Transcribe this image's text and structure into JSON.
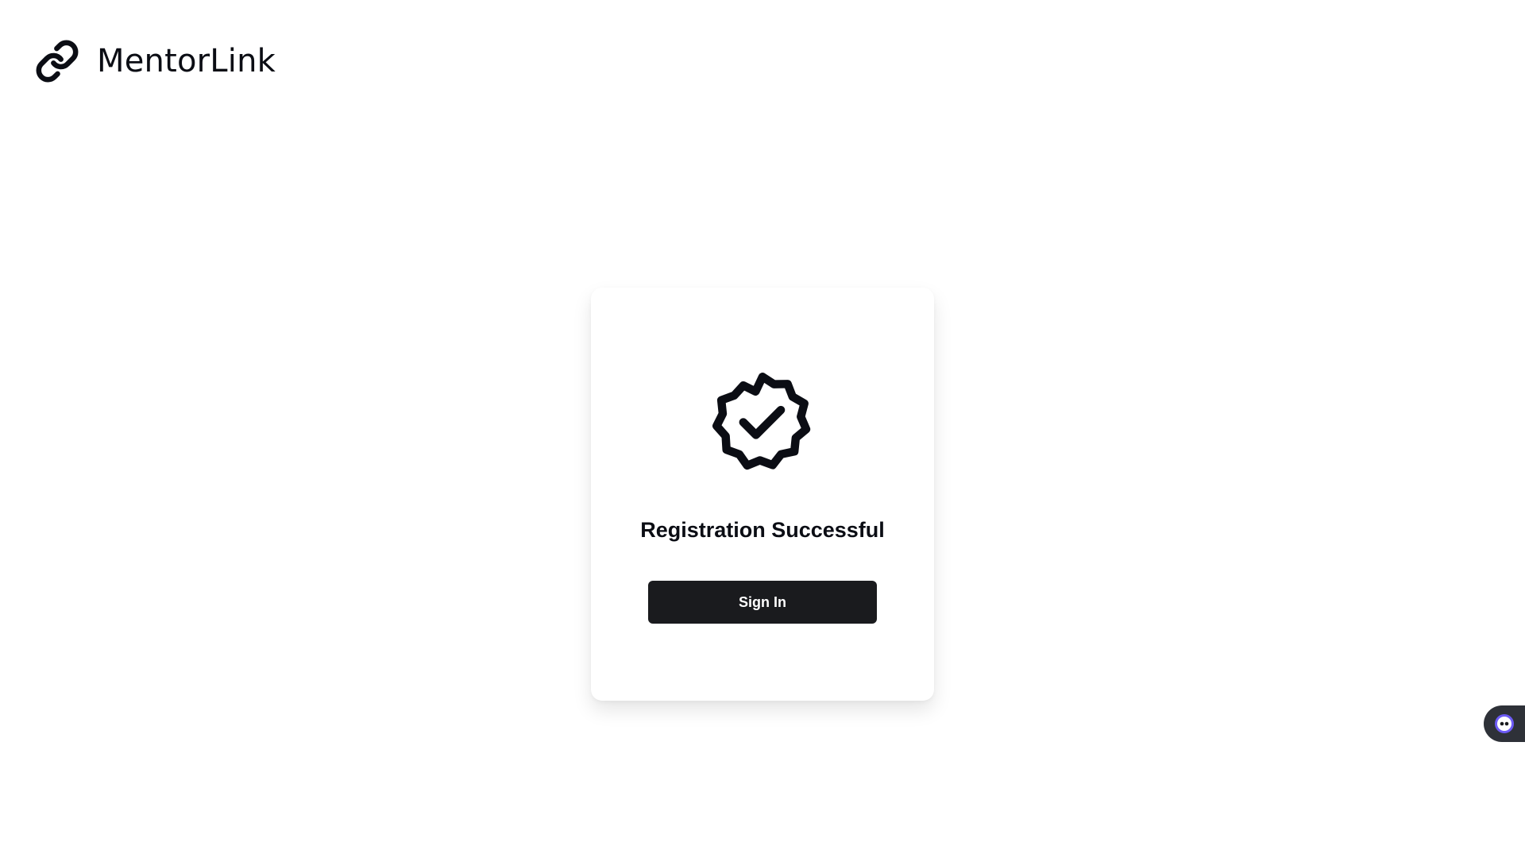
{
  "app": {
    "name": "MentorLink",
    "logo_icon": "link-chain-icon"
  },
  "card": {
    "icon": "verified-badge-check-icon",
    "title": "Registration Successful",
    "button_label": "Sign In"
  },
  "widget": {
    "icon": "chat-assistant-icon"
  },
  "colors": {
    "text": "#0b0d14",
    "button_bg": "#1a1b1e",
    "button_text": "#ffffff",
    "widget_bg": "#2e3138",
    "widget_accent": "#6d5bf5"
  }
}
